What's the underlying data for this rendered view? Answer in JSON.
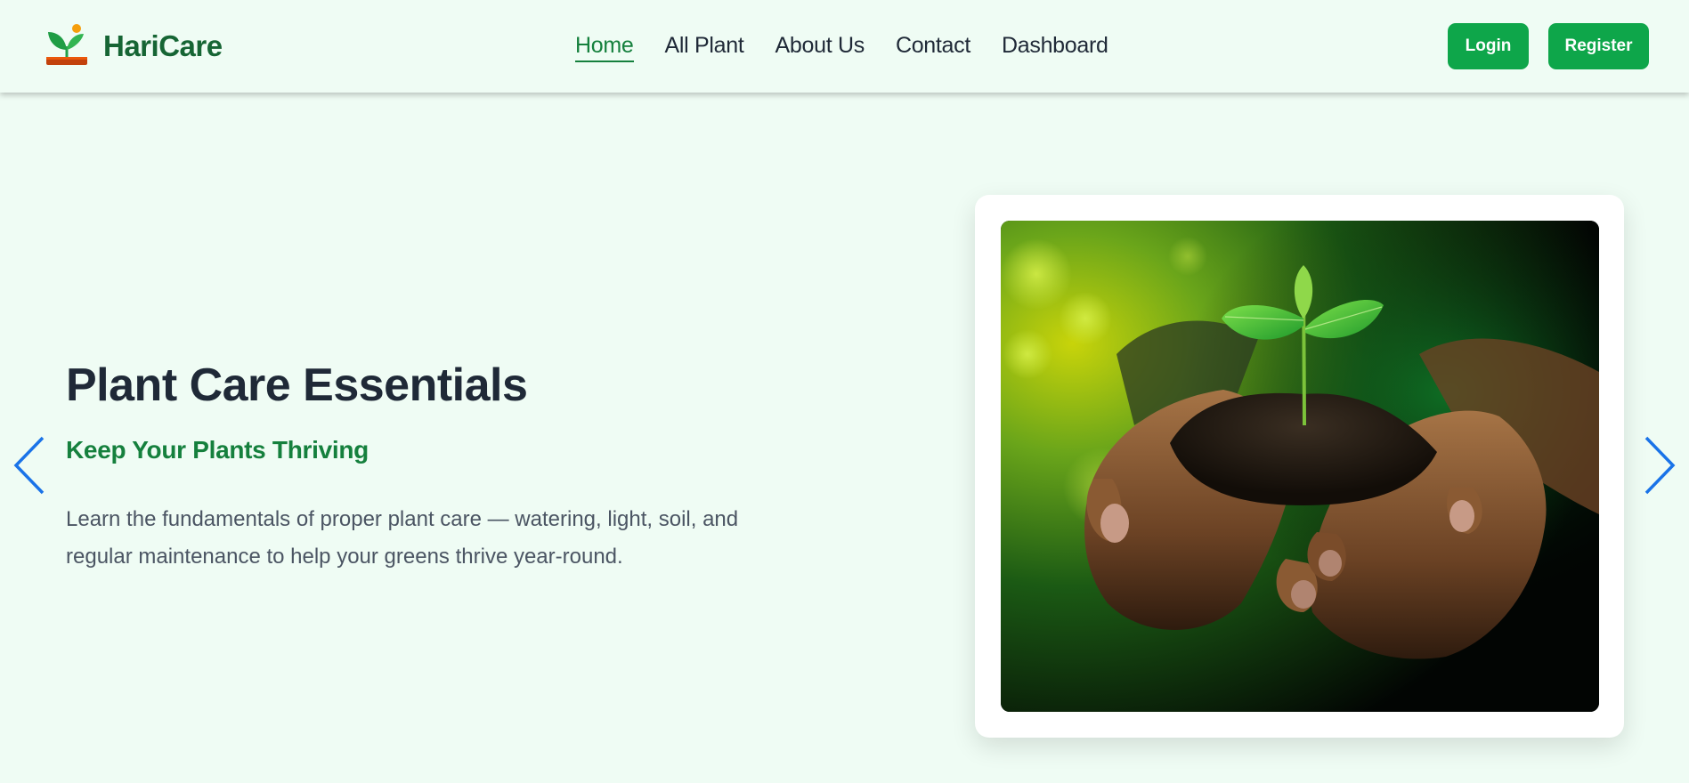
{
  "brand": {
    "name": "HariCare",
    "logo_icon": "sprout-logo-icon"
  },
  "nav": {
    "links": [
      {
        "label": "Home",
        "active": true
      },
      {
        "label": "All Plant",
        "active": false
      },
      {
        "label": "About Us",
        "active": false
      },
      {
        "label": "Contact",
        "active": false
      },
      {
        "label": "Dashboard",
        "active": false
      }
    ]
  },
  "auth": {
    "login_label": "Login",
    "register_label": "Register"
  },
  "hero": {
    "title": "Plant Care Essentials",
    "subtitle": "Keep Your Plants Thriving",
    "description": "Learn the fundamentals of proper plant care — watering, light, soil, and regular maintenance to help your greens thrive year-round.",
    "prev_icon": "chevron-left-icon",
    "next_icon": "chevron-right-icon"
  },
  "colors": {
    "page_bg": "#effcf4",
    "brand_green": "#166534",
    "accent_green": "#15803d",
    "button_green": "#0ea64a",
    "arrow_blue": "#1a73e8"
  }
}
